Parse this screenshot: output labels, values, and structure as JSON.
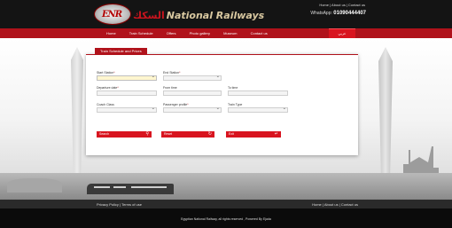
{
  "brand": {
    "logo_mark": "ENR",
    "name_ar": "السكك",
    "name_en": "National Railways"
  },
  "top_links": [
    "Home",
    "About us",
    "Contact us"
  ],
  "whatsapp": {
    "label": "WhatsApp:",
    "number": "01090444407"
  },
  "nav": {
    "items": [
      "Home",
      "Train Schedule",
      "Offers",
      "Photo gallery",
      "Museum",
      "Contact us"
    ],
    "language_button": "عربي"
  },
  "form": {
    "tab_title": "Train Schedule and Prices",
    "start_station_label": "Start Station",
    "end_station_label": "End Station",
    "departure_date_label": "Departure date",
    "from_time_label": "From time",
    "to_time_label": "To time",
    "coach_class_label": "Coach Class",
    "passenger_profile_label": "Passenger profile",
    "train_type_label": "Train Type",
    "required_mark": "*",
    "search_button": "Search",
    "reset_button": "Reset",
    "exit_button": "Exit"
  },
  "footer": {
    "left_links": [
      "Privacy Policy",
      "Terms of use"
    ],
    "right_links": [
      "Home",
      "About us",
      "Contact us"
    ],
    "copyright": "Egyptian National Railway, all rights reserved , Powered By Ejada"
  },
  "colors": {
    "brand_red": "#b0121b",
    "button_red": "#d8141f",
    "header_black": "#141414"
  }
}
